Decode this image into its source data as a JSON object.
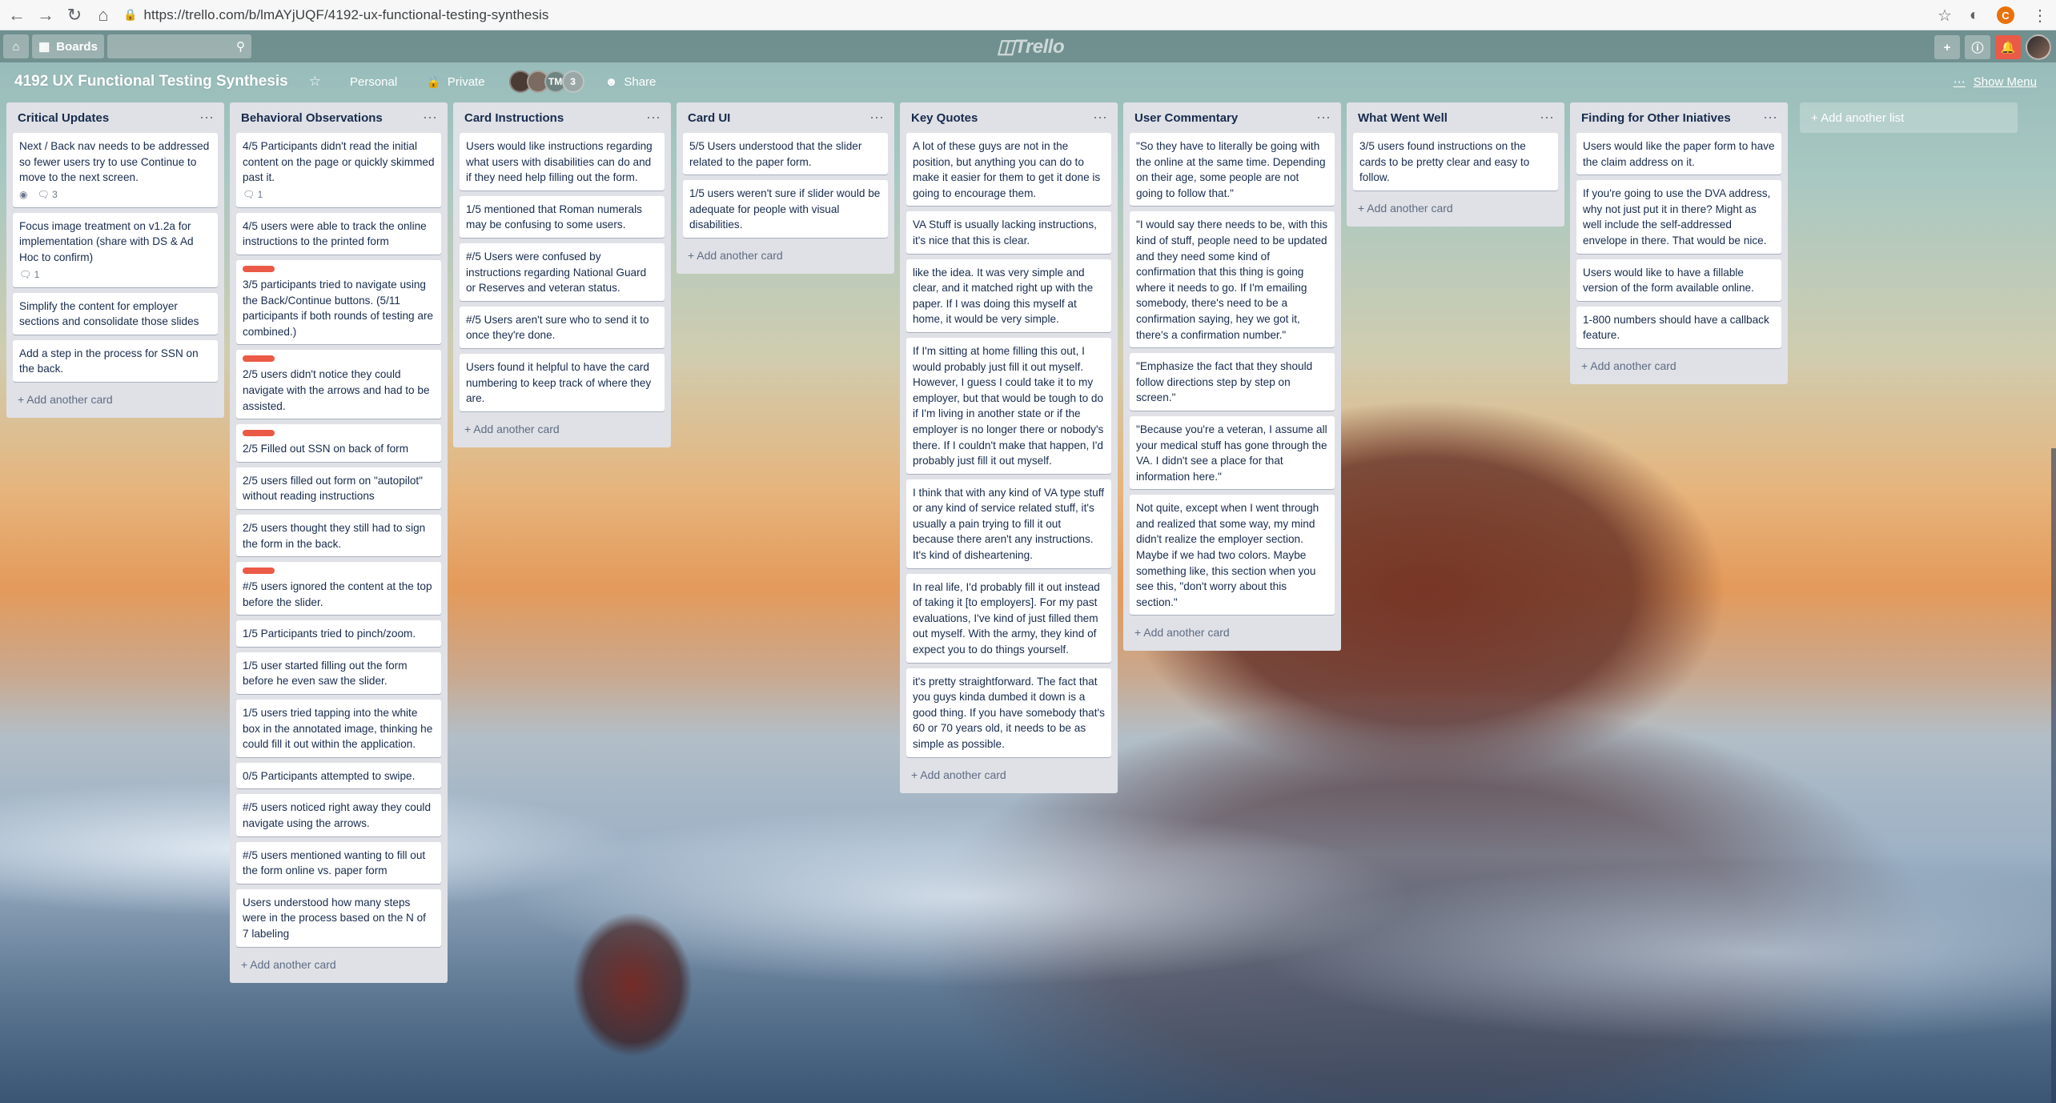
{
  "browser": {
    "url": "https://trello.com/b/lmAYjUQF/4192-ux-functional-testing-synthesis",
    "profile_initial": "C"
  },
  "header": {
    "boards_label": "Boards",
    "logo_text": "Trello"
  },
  "board": {
    "title": "4192 UX Functional Testing Synthesis",
    "visibility_team": "Personal",
    "visibility_privacy": "Private",
    "member_initials": "TM",
    "member_extra_count": "3",
    "share_label": "Share",
    "show_menu_label": "Show Menu",
    "add_list_label": "+ Add another list",
    "add_card_label": "+ Add another card"
  },
  "colors": {
    "label_red": "#eb5a46",
    "list_bg": "#dfe1e6",
    "header_bg": "#6a8b8a"
  },
  "lists": [
    {
      "title": "Critical Updates",
      "cards": [
        {
          "text": "Next / Back nav needs to be addressed so fewer users try to use Continue to move to the next screen.",
          "label": false,
          "watch": true,
          "comments": "3"
        },
        {
          "text": "Focus image treatment on v1.2a for implementation (share with DS & Ad Hoc to confirm)",
          "label": false,
          "watch": false,
          "comments": "1"
        },
        {
          "text": "Simplify the content for employer sections and consolidate those slides",
          "label": false,
          "watch": false,
          "comments": null
        },
        {
          "text": "Add a step in the process for SSN on the back.",
          "label": false,
          "watch": false,
          "comments": null
        }
      ]
    },
    {
      "title": "Behavioral Observations",
      "cards": [
        {
          "text": "4/5 Participants didn't read the initial content on the page or quickly skimmed past it.",
          "label": false,
          "watch": false,
          "comments": "1"
        },
        {
          "text": "4/5 users were able to track the online instructions to the printed form",
          "label": false,
          "watch": false,
          "comments": null
        },
        {
          "text": "3/5 participants tried to navigate using the Back/Continue buttons. (5/11 participants if both rounds of testing are combined.)",
          "label": true,
          "watch": false,
          "comments": null
        },
        {
          "text": "2/5 users didn't notice they could navigate with the arrows and had to be assisted.",
          "label": true,
          "watch": false,
          "comments": null
        },
        {
          "text": "2/5 Filled out SSN on back of form",
          "label": true,
          "watch": false,
          "comments": null
        },
        {
          "text": "2/5 users filled out form on \"autopilot\" without reading instructions",
          "label": false,
          "watch": false,
          "comments": null
        },
        {
          "text": "2/5 users thought they still had to sign the form in the back.",
          "label": false,
          "watch": false,
          "comments": null
        },
        {
          "text": "#/5 users ignored the content at the top before the slider.",
          "label": true,
          "watch": false,
          "comments": null
        },
        {
          "text": "1/5 Participants tried to pinch/zoom.",
          "label": false,
          "watch": false,
          "comments": null
        },
        {
          "text": "1/5 user started filling out the form before he even saw the slider.",
          "label": false,
          "watch": false,
          "comments": null
        },
        {
          "text": "1/5 users tried tapping into the white box in the annotated image, thinking he could fill it out within the application.",
          "label": false,
          "watch": false,
          "comments": null
        },
        {
          "text": "0/5 Participants attempted to swipe.",
          "label": false,
          "watch": false,
          "comments": null
        },
        {
          "text": "#/5 users noticed right away they could navigate using the arrows.",
          "label": false,
          "watch": false,
          "comments": null
        },
        {
          "text": "#/5 users mentioned wanting to fill out the form online vs. paper form",
          "label": false,
          "watch": false,
          "comments": null
        },
        {
          "text": "Users understood how many steps were in the process based on the N of 7 labeling",
          "label": false,
          "watch": false,
          "comments": null
        }
      ]
    },
    {
      "title": "Card Instructions",
      "cards": [
        {
          "text": "Users would like instructions regarding what users with disabilities can do and if they need help filling out the form.",
          "label": false,
          "watch": false,
          "comments": null
        },
        {
          "text": "1/5 mentioned that Roman numerals may be confusing to some users.",
          "label": false,
          "watch": false,
          "comments": null
        },
        {
          "text": "#/5 Users were confused by instructions regarding National Guard or Reserves and veteran status.",
          "label": false,
          "watch": false,
          "comments": null
        },
        {
          "text": "#/5 Users aren't sure who to send it to once they're done.",
          "label": false,
          "watch": false,
          "comments": null
        },
        {
          "text": "Users found it helpful to have the card numbering to keep track of where they are.",
          "label": false,
          "watch": false,
          "comments": null
        }
      ]
    },
    {
      "title": "Card UI",
      "cards": [
        {
          "text": "5/5 Users understood that the slider related to the paper form.",
          "label": false,
          "watch": false,
          "comments": null
        },
        {
          "text": "1/5 users weren't sure if slider would be adequate for people with visual disabilities.",
          "label": false,
          "watch": false,
          "comments": null
        }
      ]
    },
    {
      "title": "Key Quotes",
      "cards": [
        {
          "text": "A lot of these guys are not in the position, but anything you can do to make it easier for them to get it done is going to encourage them.",
          "label": false,
          "watch": false,
          "comments": null
        },
        {
          "text": "VA Stuff is usually lacking instructions, it's nice that this is clear.",
          "label": false,
          "watch": false,
          "comments": null
        },
        {
          "text": "like the idea. It was very simple and clear, and it matched right up with the paper. If I was doing this myself at home, it would be very simple.",
          "label": false,
          "watch": false,
          "comments": null
        },
        {
          "text": "If I'm sitting at home filling this out, I would probably just fill it out myself. However, I guess I could take it to my employer, but that would be tough to do if I'm living in another state or if the employer is no longer there or nobody's there. If I couldn't make that happen, I'd probably just fill it out myself.",
          "label": false,
          "watch": false,
          "comments": null
        },
        {
          "text": "I think that with any kind of VA type stuff or any kind of service related stuff, it's usually a pain trying to fill it out because there aren't any instructions. It's kind of disheartening.",
          "label": false,
          "watch": false,
          "comments": null
        },
        {
          "text": "In real life, I'd probably fill it out instead of taking it [to employers]. For my past evaluations, I've kind of just filled them out myself. With the army, they kind of expect you to do things yourself.",
          "label": false,
          "watch": false,
          "comments": null
        },
        {
          "text": "it's pretty straightforward. The fact that you guys kinda dumbed it down is a good thing. If you have somebody that's 60 or 70 years old, it needs to be as simple as possible.",
          "label": false,
          "watch": false,
          "comments": null
        }
      ]
    },
    {
      "title": "User Commentary",
      "cards": [
        {
          "text": "\"So they have to literally be going with the online at the same time. Depending on their age, some people are not going to follow that.\"",
          "label": false,
          "watch": false,
          "comments": null
        },
        {
          "text": "\"I would say there needs to be, with this kind of stuff, people need to be updated and they need some kind of confirmation that this thing is going where it needs to go. If I'm emailing somebody, there's need to be a confirmation saying, hey we got it, there's a confirmation number.\"",
          "label": false,
          "watch": false,
          "comments": null
        },
        {
          "text": "\"Emphasize the fact that they should follow directions step by step on screen.\"",
          "label": false,
          "watch": false,
          "comments": null
        },
        {
          "text": "\"Because you're a veteran, I assume all your medical stuff has gone through the VA. I didn't see a place for that information here.\"",
          "label": false,
          "watch": false,
          "comments": null
        },
        {
          "text": "Not quite, except when I went through and realized that some way, my mind didn't realize the employer section. Maybe if we had two colors. Maybe something like, this section when you see this, \"don't worry about this section.\"",
          "label": false,
          "watch": false,
          "comments": null
        }
      ]
    },
    {
      "title": "What Went Well",
      "cards": [
        {
          "text": "3/5 users found instructions on the cards to be pretty clear and easy to follow.",
          "label": false,
          "watch": false,
          "comments": null
        }
      ]
    },
    {
      "title": "Finding for Other Iniatives",
      "cards": [
        {
          "text": "Users would like the paper form to have the claim address on it.",
          "label": false,
          "watch": false,
          "comments": null
        },
        {
          "text": "If you're going to use the DVA address, why not just put it in there? Might as well include the self-addressed envelope in there. That would be nice.",
          "label": false,
          "watch": false,
          "comments": null
        },
        {
          "text": "Users would like to have a fillable version of the form available online.",
          "label": false,
          "watch": false,
          "comments": null
        },
        {
          "text": "1-800 numbers should have a callback feature.",
          "label": false,
          "watch": false,
          "comments": null
        }
      ]
    }
  ]
}
